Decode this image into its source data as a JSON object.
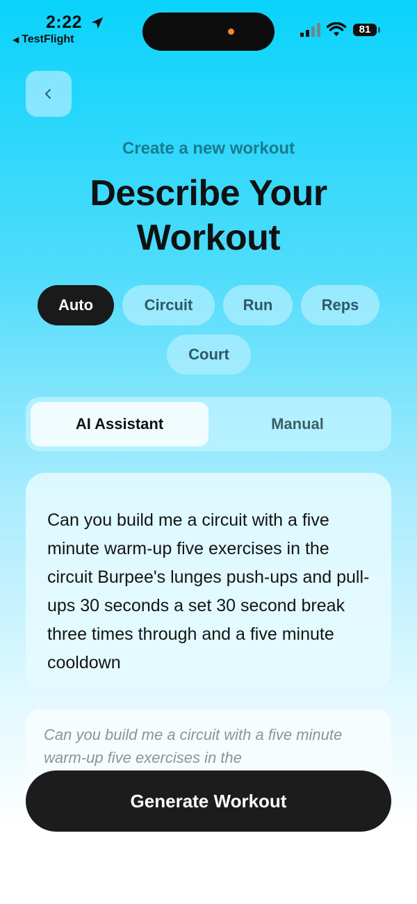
{
  "status_bar": {
    "time": "2:22",
    "back_app": "TestFlight",
    "battery": "81",
    "icons": [
      "location-arrow-icon",
      "signal-icon",
      "wifi-icon",
      "battery-icon"
    ]
  },
  "header": {
    "back_icon": "chevron-left-icon",
    "subtitle": "Create a new workout",
    "title": "Describe Your Workout"
  },
  "workout_types": [
    {
      "label": "Auto",
      "selected": true
    },
    {
      "label": "Circuit",
      "selected": false
    },
    {
      "label": "Run",
      "selected": false
    },
    {
      "label": "Reps",
      "selected": false
    },
    {
      "label": "Court",
      "selected": false
    }
  ],
  "mode_tabs": [
    {
      "label": "AI Assistant",
      "selected": true
    },
    {
      "label": "Manual",
      "selected": false
    }
  ],
  "transcript": "Can you build me a circuit with a five minute warm-up five exercises in the circuit Burpee's lunges push-ups and pull-ups 30 seconds a set 30 second break three times through and a five minute cooldown",
  "input": {
    "placeholder": "Can you build me a circuit with a five minute warm-up five exercises in the"
  },
  "generate_label": "Generate Workout",
  "colors": {
    "accent_dark": "#1a1a1a",
    "gradient_top": "#0ad3fb",
    "subtitle": "#1a7a8f"
  }
}
